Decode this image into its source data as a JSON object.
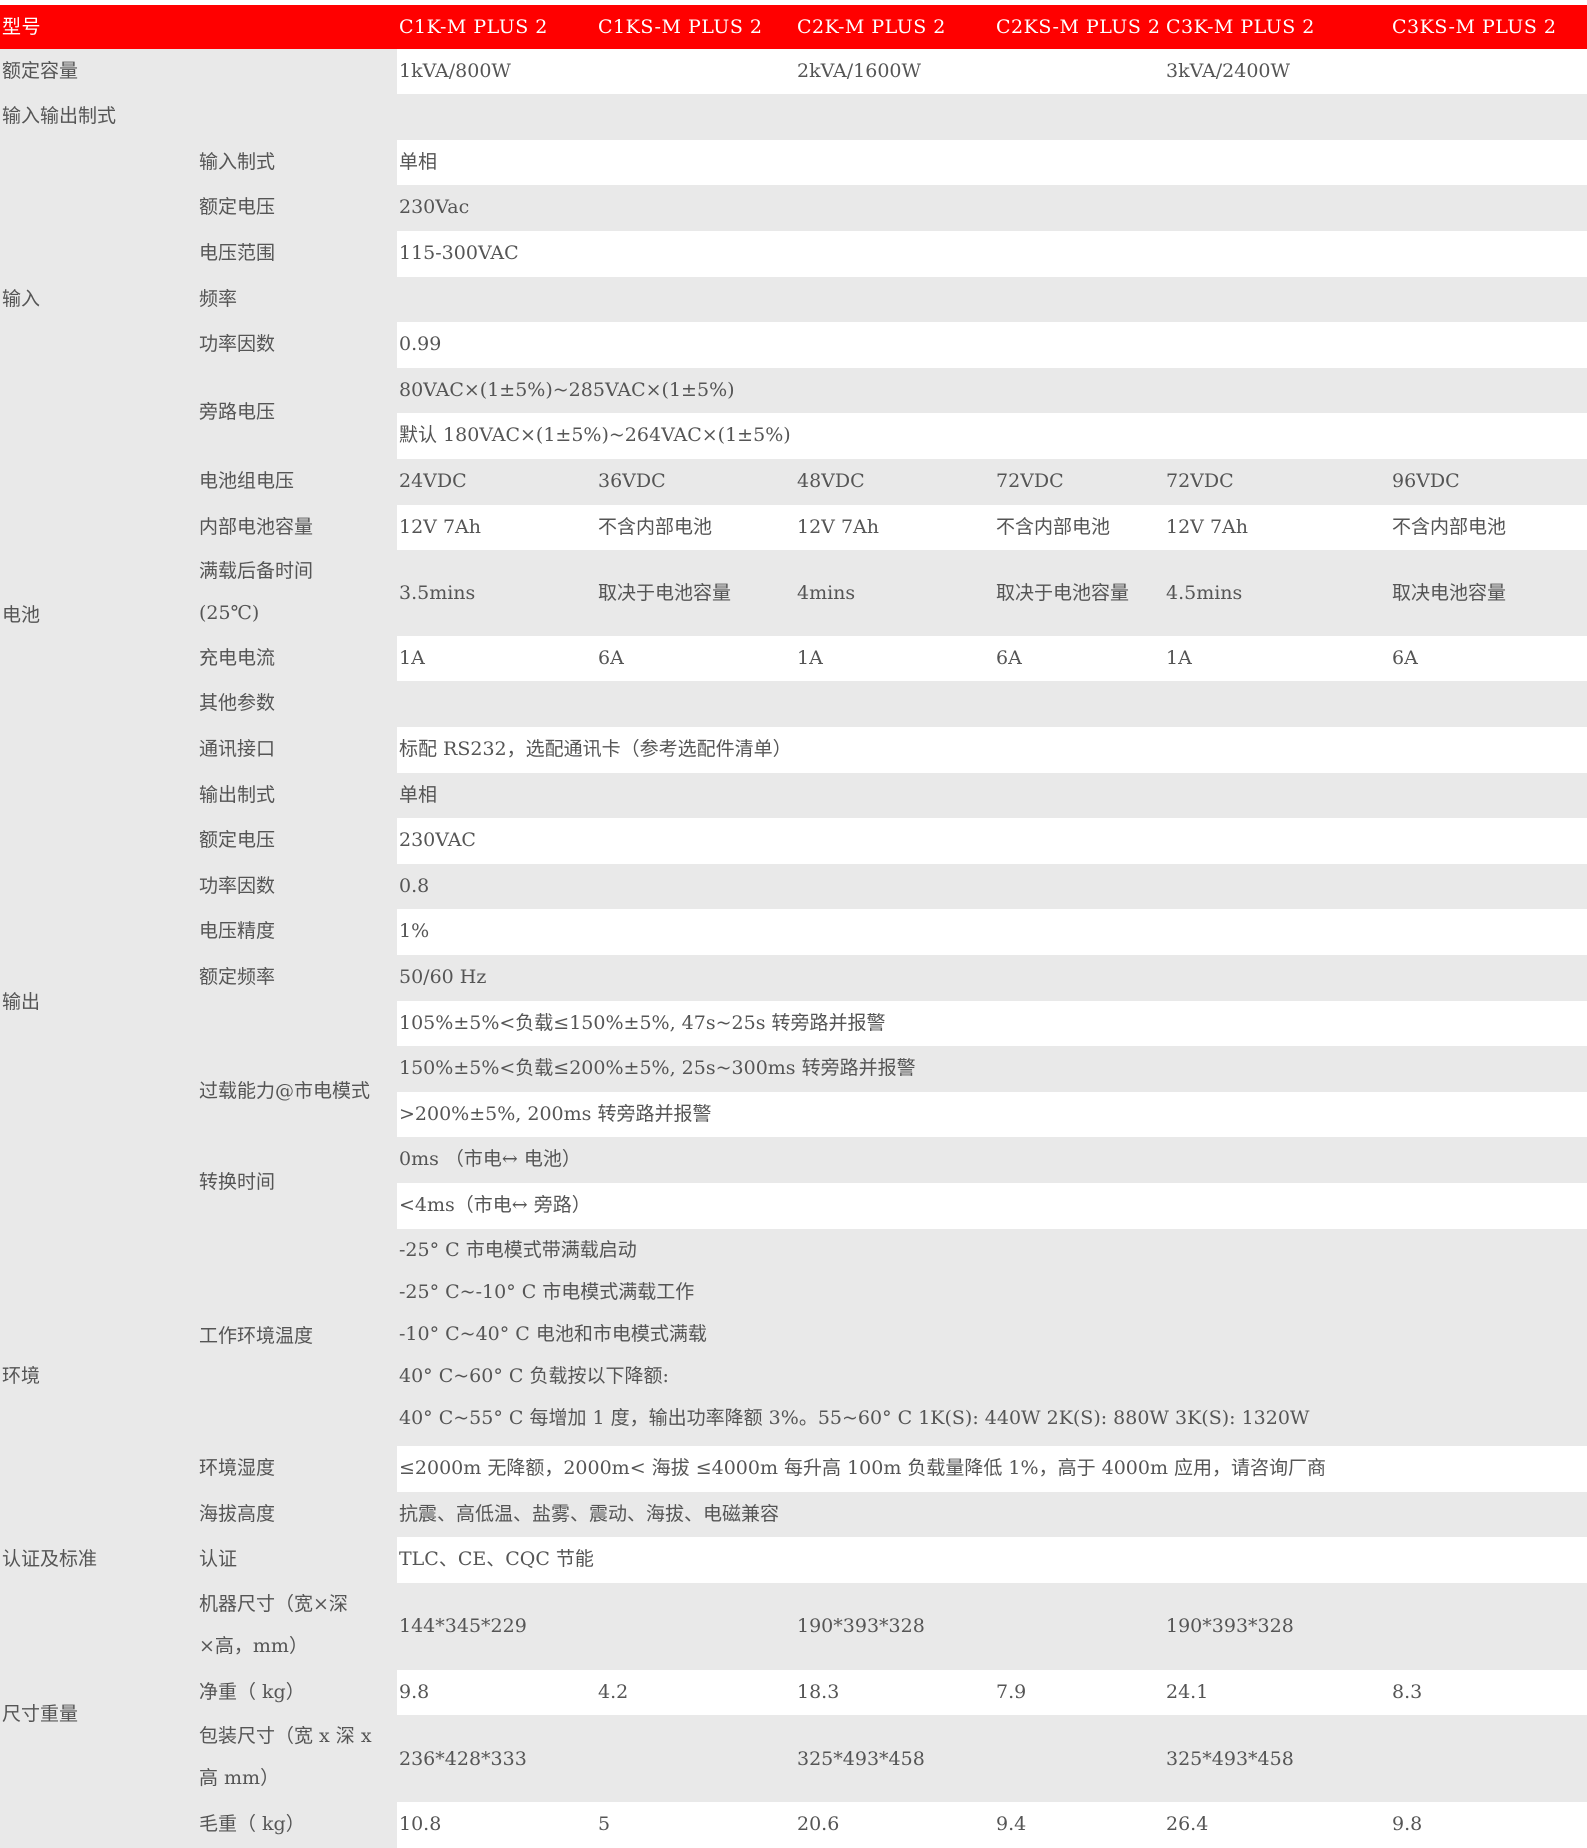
{
  "header": {
    "model_label": "型号",
    "models": [
      "C1K-M PLUS 2",
      "C1KS-M PLUS 2",
      "C2K-M PLUS 2",
      "C2KS-M PLUS 2",
      "C3K-M PLUS 2",
      "C3KS-M PLUS 2"
    ],
    "colors": {
      "header_bg": "#ff0000",
      "header_text": "#ffffff",
      "row_gray": "#e9e9e9",
      "text": "#555555"
    }
  },
  "rated_capacity": {
    "label": "额定容量",
    "values": [
      "1kVA/800W",
      "2kVA/1600W",
      "3kVA/2400W"
    ]
  },
  "io_mode": {
    "label": "输入输出制式"
  },
  "input": {
    "group": "输入",
    "mode": {
      "label": "输入制式",
      "value": "单相"
    },
    "rated_voltage": {
      "label": "额定电压",
      "value": "230Vac"
    },
    "voltage_range": {
      "label": "电压范围",
      "value": "115-300VAC"
    },
    "frequency": {
      "label": "频率",
      "value": ""
    },
    "power_factor": {
      "label": "功率因数",
      "value": "0.99"
    },
    "bypass_voltage": {
      "label": "旁路电压",
      "values": [
        "80VAC×(1±5%)~285VAC×(1±5%)",
        "默认 180VAC×(1±5%)~264VAC×(1±5%)"
      ]
    }
  },
  "battery": {
    "group": "电池",
    "pack_voltage": {
      "label": "电池组电压",
      "values": [
        "24VDC",
        "36VDC",
        "48VDC",
        "72VDC",
        "72VDC",
        "96VDC"
      ]
    },
    "internal_capacity": {
      "label": "内部电池容量",
      "values": [
        "12V 7Ah",
        "不含内部电池",
        "12V 7Ah",
        "不含内部电池",
        "12V 7Ah",
        "不含内部电池"
      ]
    },
    "backup_time": {
      "label_lines": [
        "满载后备时间",
        "(25℃)"
      ],
      "values": [
        "3.5mins",
        "取决于电池容量",
        "4mins",
        "取决于电池容量",
        "4.5mins",
        "取决电池容量"
      ]
    },
    "charge_current": {
      "label": "充电电流",
      "values": [
        "1A",
        "6A",
        "1A",
        "6A",
        "1A",
        "6A"
      ]
    }
  },
  "other": {
    "label": "其他参数"
  },
  "output": {
    "group": "输出",
    "interface": {
      "label": "通讯接口",
      "value": "标配 RS232，选配通讯卡（参考选配件清单）"
    },
    "mode": {
      "label": "输出制式",
      "value": "单相"
    },
    "rated_voltage": {
      "label": "额定电压",
      "value": "230VAC"
    },
    "power_factor": {
      "label": "功率因数",
      "value": "0.8"
    },
    "voltage_accuracy": {
      "label": "电压精度",
      "value": "1%"
    },
    "rated_frequency": {
      "label": "额定频率",
      "value": "50/60 Hz"
    },
    "overload": {
      "label": "过载能力@市电模式",
      "values": [
        "105%±5%<负载≤150%±5%, 47s~25s 转旁路并报警",
        "150%±5%<负载≤200%±5%, 25s~300ms 转旁路并报警",
        ">200%±5%, 200ms 转旁路并报警"
      ]
    },
    "transfer_time": {
      "label": "转换时间",
      "values": [
        "0ms （市电↔ 电池）",
        "<4ms（市电↔ 旁路）"
      ]
    }
  },
  "environment": {
    "group": "环境",
    "operating_temp": {
      "label": "工作环境温度",
      "lines": [
        "-25° C 市电模式带满载启动",
        "-25° C~-10° C 市电模式满载工作",
        "-10° C~40° C 电池和市电模式满载",
        "40° C~60° C 负载按以下降额:",
        "40° C~55° C 每增加 1 度，输出功率降额 3%。55~60° C 1K(S): 440W 2K(S): 880W 3K(S): 1320W"
      ]
    },
    "humidity": {
      "label": "环境湿度",
      "value": "≤2000m 无降额，2000m< 海拔 ≤4000m 每升高 100m 负载量降低 1%，高于 4000m 应用，请咨询厂商"
    },
    "altitude": {
      "label": "海拔高度",
      "value": "抗震、高低温、盐雾、震动、海拔、电磁兼容"
    }
  },
  "certification": {
    "group": "认证及标准",
    "cert": {
      "label": "认证",
      "value": "TLC、CE、CQC 节能"
    }
  },
  "dimensions": {
    "group": "尺寸重量",
    "machine_size": {
      "label_lines": [
        "机器尺寸（宽×深",
        "×高，mm）"
      ],
      "values": [
        "144*345*229",
        "190*393*328",
        "190*393*328"
      ]
    },
    "net_weight": {
      "label": "净重（ kg）",
      "values": [
        "9.8",
        "4.2",
        "18.3",
        "7.9",
        "24.1",
        "8.3"
      ]
    },
    "package_size": {
      "label_lines": [
        "包装尺寸（宽 x 深 x",
        "高 mm）"
      ],
      "values": [
        "236*428*333",
        "325*493*458",
        "325*493*458"
      ]
    },
    "gross_weight": {
      "label": "毛重（ kg）",
      "values": [
        "10.8",
        "5",
        "20.6",
        "9.4",
        "26.4",
        "9.8"
      ]
    }
  }
}
